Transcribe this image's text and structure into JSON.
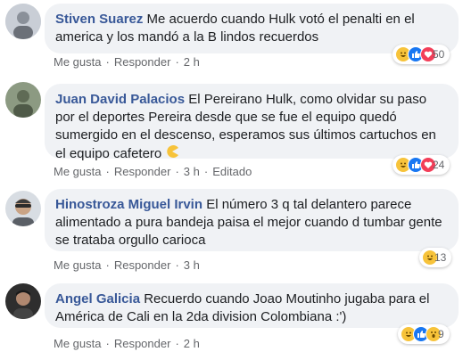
{
  "comments": [
    {
      "author": "Stiven Suarez",
      "text": "Me acuerdo cuando Hulk votó el penalti en el america y los mandó a la B lindos recuerdos",
      "actions": {
        "like": "Me gusta",
        "reply": "Responder",
        "time": "2 h",
        "edited": ""
      },
      "reactions": {
        "types": [
          "haha-icon",
          "like-icon",
          "love-icon"
        ],
        "count": "50"
      }
    },
    {
      "author": "Juan David Palacios",
      "text": "El Pereirano Hulk, como olvidar su paso por el deportes Pereira desde que se fue el equipo quedó sumergido en el descenso, esperamos sus últimos cartuchos en el equipo cafetero",
      "trailing_emoji": "pacman-emoji-icon",
      "actions": {
        "like": "Me gusta",
        "reply": "Responder",
        "time": "3 h",
        "edited": "Editado"
      },
      "reactions": {
        "types": [
          "haha-icon",
          "like-icon",
          "love-icon"
        ],
        "count": "24"
      }
    },
    {
      "author": "Hinostroza Miguel Irvin",
      "text": "El número 3 q tal delantero parece alimentado a pura bandeja paisa el mejor cuando d tumbar gente se trataba orgullo carioca",
      "actions": {
        "like": "Me gusta",
        "reply": "Responder",
        "time": "3 h",
        "edited": ""
      },
      "reactions": {
        "types": [
          "haha-icon"
        ],
        "count": "13"
      }
    },
    {
      "author": "Angel Galicia",
      "text": "Recuerdo cuando Joao Moutinho jugaba para el América de Cali en la 2da division Colombiana :')",
      "actions": {
        "like": "Me gusta",
        "reply": "Responder",
        "time": "2 h",
        "edited": ""
      },
      "reactions": {
        "types": [
          "haha-icon",
          "like-icon",
          "wow-icon"
        ],
        "count": "9"
      }
    }
  ],
  "colors": {
    "author": "#385898",
    "bubble": "#f0f2f5",
    "meta": "#65676b"
  }
}
